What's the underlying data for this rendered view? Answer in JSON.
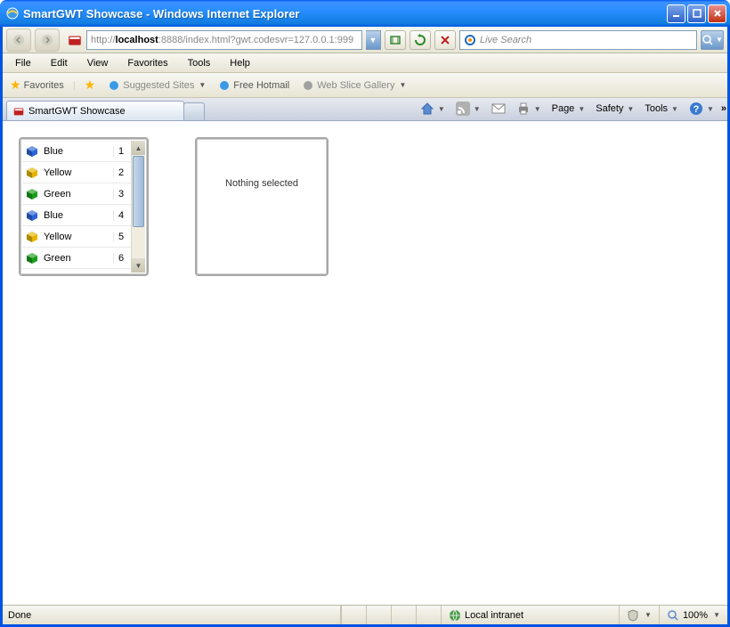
{
  "window": {
    "title": "SmartGWT Showcase - Windows Internet Explorer"
  },
  "address": {
    "prefix": "http://",
    "host": "localhost",
    "rest": ":8888/index.html?gwt.codesvr=127.0.0.1:999"
  },
  "search": {
    "placeholder": "Live Search"
  },
  "menus": [
    "File",
    "Edit",
    "View",
    "Favorites",
    "Tools",
    "Help"
  ],
  "fav": {
    "label": "Favorites",
    "links": [
      "Suggested Sites",
      "Free Hotmail",
      "Web Slice Gallery"
    ]
  },
  "tab": {
    "title": "SmartGWT Showcase"
  },
  "cmdbar": [
    "Page",
    "Safety",
    "Tools"
  ],
  "list": [
    {
      "color": "#2a66d8",
      "label": "Blue",
      "n": "1"
    },
    {
      "color": "#e6b400",
      "label": "Yellow",
      "n": "2"
    },
    {
      "color": "#1a9e1a",
      "label": "Green",
      "n": "3"
    },
    {
      "color": "#2a66d8",
      "label": "Blue",
      "n": "4"
    },
    {
      "color": "#e6b400",
      "label": "Yellow",
      "n": "5"
    },
    {
      "color": "#1a9e1a",
      "label": "Green",
      "n": "6"
    }
  ],
  "detail": {
    "empty": "Nothing selected"
  },
  "status": {
    "left": "Done",
    "zone": "Local intranet",
    "zoom": "100%"
  }
}
